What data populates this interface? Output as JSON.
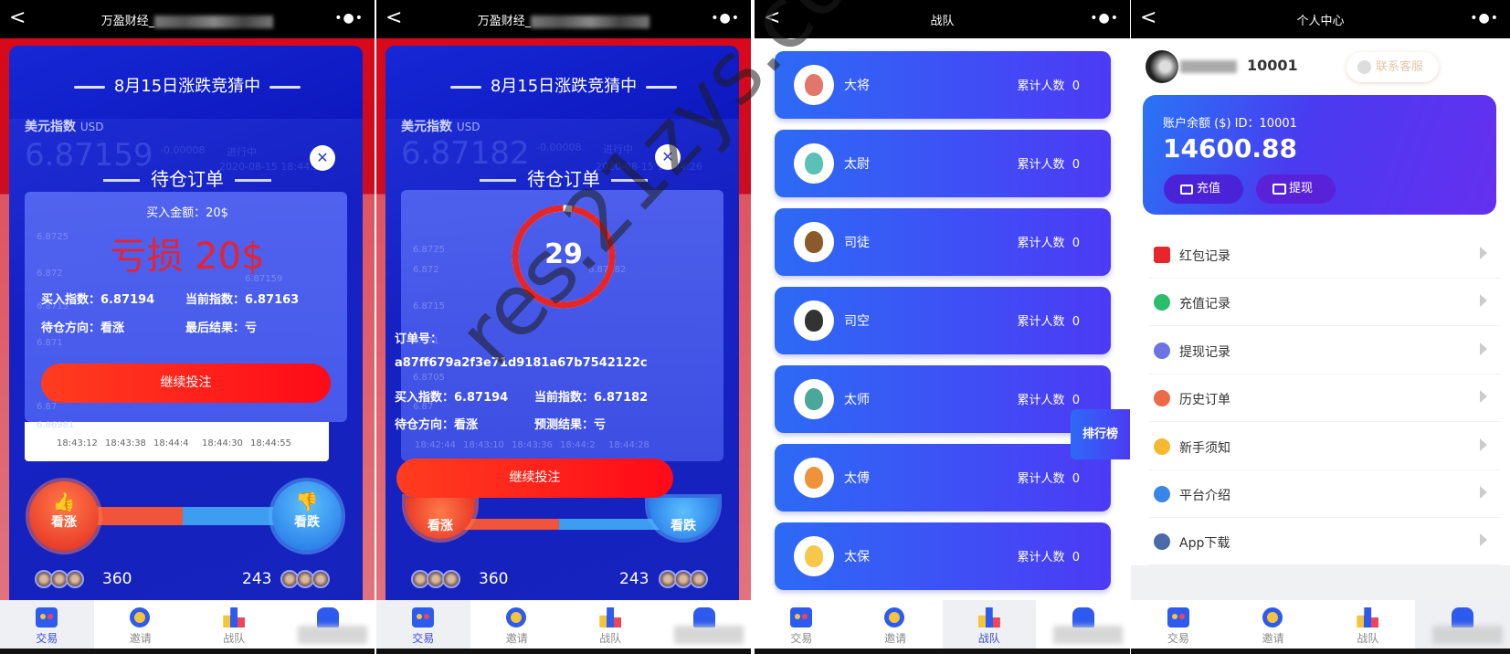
{
  "nav": {
    "tabs": [
      "交易",
      "邀请",
      "战队"
    ]
  },
  "header": {
    "back": "<",
    "more": "•●•"
  },
  "trade": {
    "app_title": "万盈财经_",
    "banner": "8月15日涨跌竞猜中",
    "index_name": "美元指数",
    "index_unit": "USD",
    "modal_title": "待仓订单",
    "close": "✕",
    "continue_button": "继续投注",
    "up_label": "看涨",
    "down_label": "看跌",
    "up_count": "360",
    "down_count": "243"
  },
  "panel1": {
    "price": "6.87159",
    "change": "-0.00008",
    "status": "进行中",
    "time": "2020-08-15 18:44:57",
    "amount": "买入金额：20$",
    "result_big": "亏损 20$",
    "buy_index": "买入指数：6.87194",
    "current_index": "当前指数：6.87163",
    "direction": "待仓方向：看涨",
    "final": "最后结果：亏",
    "y_ticks": [
      "6.8725",
      "6.872",
      "6.8715",
      "6.871",
      "6.87",
      "6.86981"
    ],
    "price_marker": "6.87159",
    "x_ticks": [
      "18:43:12",
      "18:43:38",
      "18:44:4",
      "18:44:30",
      "18:44:55"
    ]
  },
  "panel2": {
    "price": "6.87182",
    "change": "-0.00008",
    "status": "进行中",
    "time": "2020-08-15 18:44:26",
    "countdown": "29",
    "countdown_progress": 0.97,
    "order_label": "订单号：",
    "order_no": "a87ff679a2f3e71d9181a67b7542122c",
    "buy_index": "买入指数：6.87194",
    "current_index": "当前指数：6.87182",
    "direction": "待仓方向：看涨",
    "forecast": "预测结果：亏",
    "y_ticks": [
      "6.8725",
      "6.872",
      "6.8715",
      "6.871",
      "6.8705",
      "6.87"
    ],
    "price_marker": "6.87182",
    "x_ticks": [
      "18:42:44",
      "18:43:10",
      "18:43:36",
      "18:44:2",
      "18:44:28"
    ]
  },
  "team": {
    "title": "战队",
    "count_label": "累计人数",
    "rank_button": "排行榜",
    "items": [
      {
        "name": "大将",
        "count": "0",
        "color": "#e2766a"
      },
      {
        "name": "太尉",
        "count": "0",
        "color": "#5bc0b5"
      },
      {
        "name": "司徒",
        "count": "0",
        "color": "#8a5a2a"
      },
      {
        "name": "司空",
        "count": "0",
        "color": "#333333"
      },
      {
        "name": "太师",
        "count": "0",
        "color": "#4aa89a"
      },
      {
        "name": "太傅",
        "count": "0",
        "color": "#f0923a"
      },
      {
        "name": "太保",
        "count": "0",
        "color": "#f5c84a"
      }
    ]
  },
  "me": {
    "title": "个人中心",
    "user_id": "10001",
    "contact": "联系客服",
    "balance_label": "账户余额 ($) ID：10001",
    "balance": "14600.88",
    "recharge": "充值",
    "withdraw": "提现",
    "menu": [
      {
        "label": "红包记录",
        "icon": "red-envelope-icon",
        "color": "#e8252b"
      },
      {
        "label": "充值记录",
        "icon": "recharge-icon",
        "color": "#2bbd6a"
      },
      {
        "label": "提现记录",
        "icon": "wallet-icon",
        "color": "#6b74e0"
      },
      {
        "label": "历史订单",
        "icon": "clipboard-icon",
        "color": "#ec6a45"
      },
      {
        "label": "新手须知",
        "icon": "info-icon",
        "color": "#f5b82e"
      },
      {
        "label": "平台介绍",
        "icon": "list-icon",
        "color": "#3a86e8"
      },
      {
        "label": "App下载",
        "icon": "box-icon",
        "color": "#4a6aa8"
      }
    ]
  },
  "watermark": "res.21zys.com"
}
